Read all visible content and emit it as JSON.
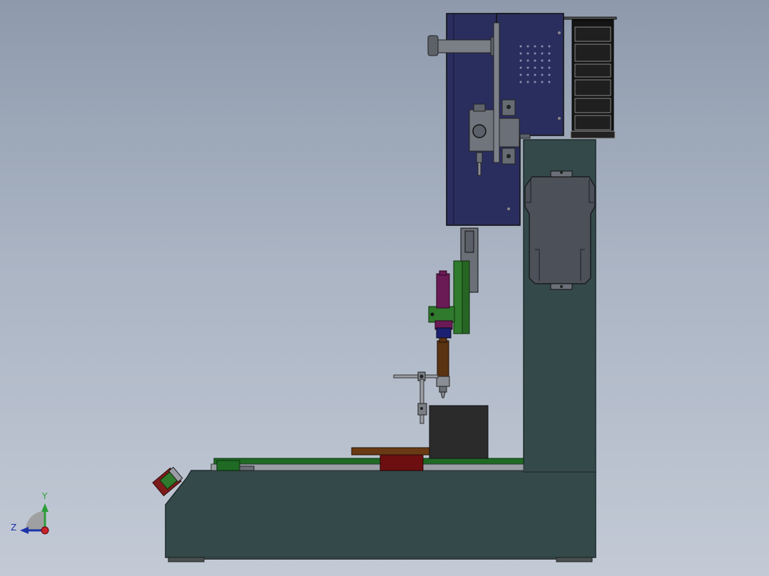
{
  "viewport": {
    "background_top": "#8e9aac",
    "background_bottom": "#c3cad6"
  },
  "triad": {
    "y_label": "Y",
    "z_label": "Z",
    "y_color": "#2f9e3a",
    "z_color": "#1c33a8",
    "x_color": "#c8232b"
  },
  "colors": {
    "frame": "#34494a",
    "upper_box": "#2a2e5e",
    "cable_chain": "#141414",
    "carrier_panel": "#4b5059",
    "syringe": "#6a1a55",
    "nozzle_body": "#5a3313",
    "mount_bracket": "#2f7a2c",
    "table_plate": "#6a3a14",
    "table_block": "#6d0f10",
    "workpiece": "#2b2b2b",
    "emergency_button": "#7d1b1b"
  }
}
